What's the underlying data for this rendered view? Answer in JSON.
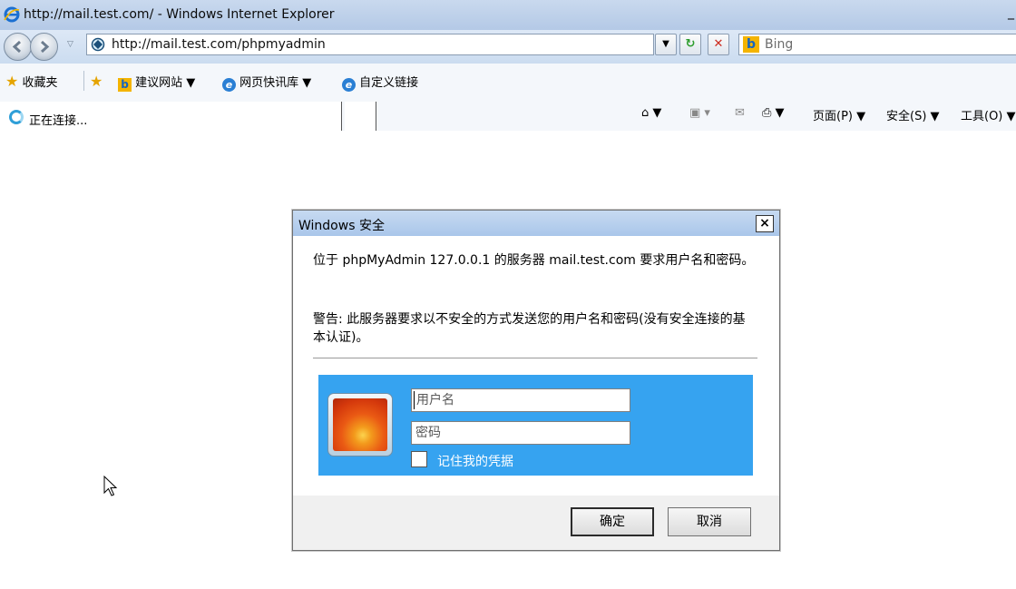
{
  "window": {
    "title": "http://mail.test.com/ - Windows Internet Explorer",
    "minimize_glyph": "_"
  },
  "nav": {
    "address_url": "http://mail.test.com/phpmyadmin",
    "search_placeholder": "Bing"
  },
  "favorites": {
    "favorites_label": "收藏夹",
    "items": [
      {
        "label": "建议网站 ▼",
        "icon": "bing-icon"
      },
      {
        "label": "网页快讯库 ▼",
        "icon": "ie-page-icon"
      },
      {
        "label": "自定义链接",
        "icon": "ie-page-icon"
      }
    ]
  },
  "tab": {
    "label": "正在连接..."
  },
  "commandbar": {
    "page_menu": "页面(P) ▼",
    "safety_menu": "安全(S) ▼",
    "tools_menu": "工具(O) ▼"
  },
  "dialog": {
    "title": "Windows 安全",
    "close_glyph": "×",
    "message": "位于 phpMyAdmin 127.0.0.1 的服务器 mail.test.com 要求用户名和密码。",
    "warning": "警告: 此服务器要求以不安全的方式发送您的用户名和密码(没有安全连接的基本认证)。",
    "username_placeholder": "用户名",
    "password_placeholder": "密码",
    "remember_label": "记住我的凭据",
    "ok_label": "确定",
    "cancel_label": "取消"
  },
  "colors": {
    "credential_panel": "#36a3f0",
    "titlebar": "#b4c9e6"
  }
}
